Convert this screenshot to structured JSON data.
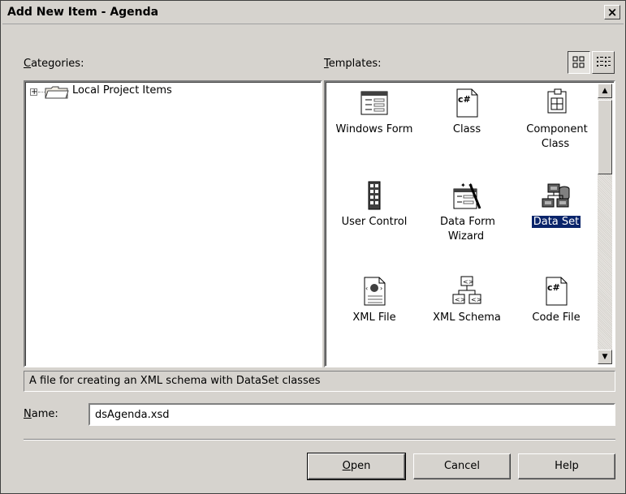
{
  "window": {
    "title": "Add New Item - Agenda",
    "close_glyph": "×"
  },
  "categories": {
    "label": "Categories:",
    "tree": [
      {
        "expander": "+",
        "icon": "folder-icon",
        "label": "Local Project Items"
      }
    ]
  },
  "templates": {
    "label": "Templates:",
    "view_buttons": [
      {
        "name": "large-icons-view",
        "pressed": true
      },
      {
        "name": "small-icons-view",
        "pressed": false
      }
    ],
    "items": [
      {
        "label": "Windows Form",
        "icon": "windows-form-icon"
      },
      {
        "label": "Class",
        "icon": "csharp-class-icon"
      },
      {
        "label": "Component Class",
        "icon": "component-class-icon"
      },
      {
        "label": "User Control",
        "icon": "user-control-icon"
      },
      {
        "label": "Data Form Wizard",
        "icon": "data-form-wizard-icon"
      },
      {
        "label": "Data Set",
        "icon": "data-set-icon",
        "selected": true
      },
      {
        "label": "XML File",
        "icon": "xml-file-icon"
      },
      {
        "label": "XML Schema",
        "icon": "xml-schema-icon"
      },
      {
        "label": "Code File",
        "icon": "code-file-icon"
      }
    ]
  },
  "description": "A file for creating an XML schema with DataSet classes",
  "name_field": {
    "label": "Name:",
    "value": "dsAgenda.xsd"
  },
  "buttons": {
    "open": "Open",
    "cancel": "Cancel",
    "help": "Help"
  }
}
